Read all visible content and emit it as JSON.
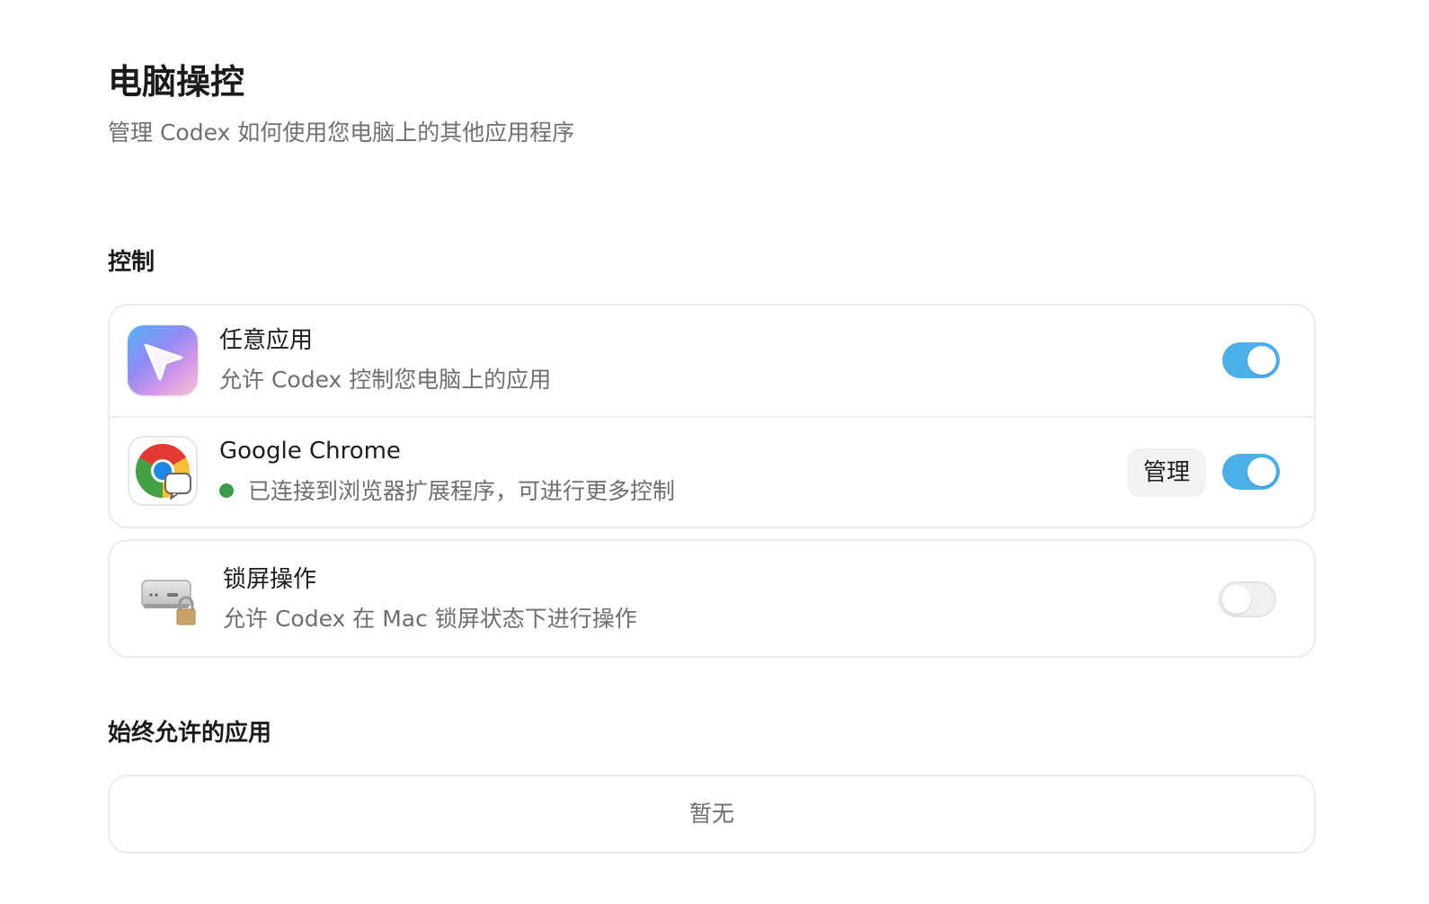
{
  "header": {
    "title": "电脑操控",
    "subtitle": "管理 Codex 如何使用您电脑上的其他应用程序"
  },
  "control_section": {
    "title": "控制",
    "rows": [
      {
        "title": "任意应用",
        "description": "允许 Codex 控制您电脑上的应用",
        "icon": "cursor-arrow-app-icon",
        "enabled": true
      },
      {
        "title": "Google Chrome",
        "description": "已连接到浏览器扩展程序，可进行更多控制",
        "icon": "chrome-icon",
        "status_color": "#3a9b49",
        "manage_label": "管理",
        "enabled": true
      }
    ],
    "lock_row": {
      "title": "锁屏操作",
      "description": "允许 Codex 在 Mac 锁屏状态下进行操作",
      "icon": "mac-mini-lock-icon",
      "enabled": false
    }
  },
  "always_allowed_section": {
    "title": "始终允许的应用",
    "empty_text": "暂无"
  },
  "colors": {
    "toggle_on": "#4cb0e8",
    "toggle_off": "#f1f1f1"
  }
}
